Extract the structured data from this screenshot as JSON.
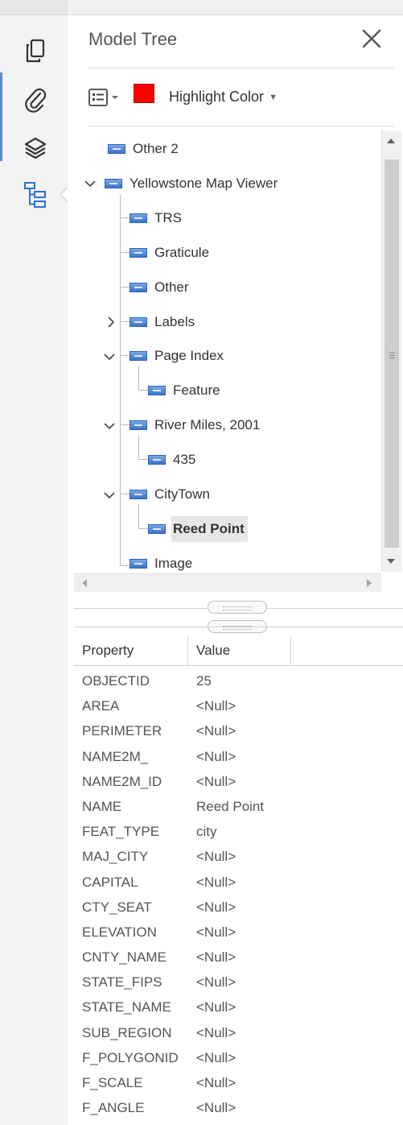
{
  "panel": {
    "title": "Model Tree"
  },
  "toolbar": {
    "highlight_label": "Highlight Color",
    "highlight_color": "#ff0000"
  },
  "tree": {
    "nodes": [
      {
        "label": "Other 2"
      },
      {
        "label": "Yellowstone Map Viewer"
      },
      {
        "label": "TRS"
      },
      {
        "label": "Graticule"
      },
      {
        "label": "Other"
      },
      {
        "label": "Labels"
      },
      {
        "label": "Page Index"
      },
      {
        "label": "Feature"
      },
      {
        "label": "River Miles, 2001"
      },
      {
        "label": "435"
      },
      {
        "label": "CityTown"
      },
      {
        "label": "Reed Point"
      },
      {
        "label": "Image"
      }
    ]
  },
  "properties": {
    "headers": {
      "property": "Property",
      "value": "Value"
    },
    "rows": [
      {
        "key": "OBJECTID",
        "value": "25"
      },
      {
        "key": "AREA",
        "value": "<Null>"
      },
      {
        "key": "PERIMETER",
        "value": "<Null>"
      },
      {
        "key": "NAME2M_",
        "value": "<Null>"
      },
      {
        "key": "NAME2M_ID",
        "value": "<Null>"
      },
      {
        "key": "NAME",
        "value": "Reed Point"
      },
      {
        "key": "FEAT_TYPE",
        "value": "city"
      },
      {
        "key": "MAJ_CITY",
        "value": "<Null>"
      },
      {
        "key": "CAPITAL",
        "value": "<Null>"
      },
      {
        "key": "CTY_SEAT",
        "value": "<Null>"
      },
      {
        "key": "ELEVATION",
        "value": "<Null>"
      },
      {
        "key": "CNTY_NAME",
        "value": "<Null>"
      },
      {
        "key": "STATE_FIPS",
        "value": "<Null>"
      },
      {
        "key": "STATE_NAME",
        "value": "<Null>"
      },
      {
        "key": "SUB_REGION",
        "value": "<Null>"
      },
      {
        "key": "F_POLYGONID",
        "value": "<Null>"
      },
      {
        "key": "F_SCALE",
        "value": "<Null>"
      },
      {
        "key": "F_ANGLE",
        "value": "<Null>"
      }
    ]
  },
  "colors": {
    "accent": "#5a8bd6",
    "node_icon": "#3c74c9",
    "selection": "#e6e6e6"
  },
  "icons": {
    "rail": [
      "pages-icon",
      "attachments-icon",
      "layers-icon",
      "model-tree-icon"
    ],
    "panel": [
      "close-icon",
      "options-icon",
      "dropdown-caret-icon",
      "expand-icon",
      "collapse-icon"
    ]
  }
}
